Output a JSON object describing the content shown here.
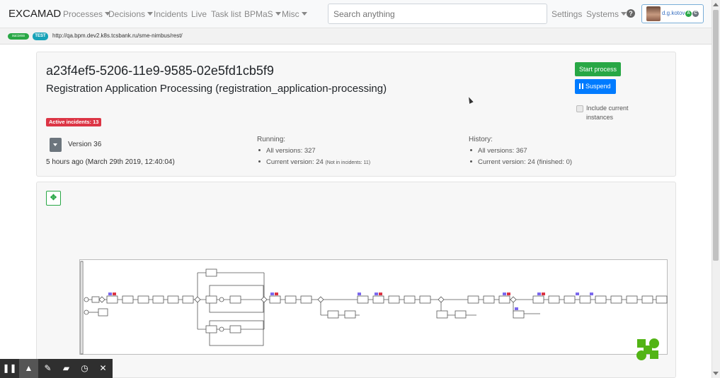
{
  "navbar": {
    "brand": "EXCAMAD",
    "items": [
      {
        "label": "Processes",
        "dropdown": true
      },
      {
        "label": "Decisions",
        "dropdown": true
      },
      {
        "label": "Incidents",
        "dropdown": false
      },
      {
        "label": "Live",
        "dropdown": false
      },
      {
        "label": "Task list",
        "dropdown": false
      },
      {
        "label": "BPMaS",
        "dropdown": true
      },
      {
        "label": "Misc",
        "dropdown": true
      }
    ],
    "search_placeholder": "Search anything",
    "settings": "Settings",
    "systems": "Systems",
    "help_icon": "?",
    "user": {
      "name": "d.g.kotov",
      "badge_a": "A",
      "badge_c": "C"
    }
  },
  "urlbar": {
    "status_badge": "success",
    "env_badge": "TEST",
    "url": "http://qa.bpm.dev2.k8s.tcsbank.ru/sme-nimbus/rest/"
  },
  "process": {
    "id": "a23f4ef5-5206-11e9-9585-02e5fd1cb5f9",
    "name": "Registration Application Processing (registration_application-processing)",
    "start_button": "Start process",
    "suspend_button": "Suspend",
    "include_current": "Include current instances",
    "active_incidents": "Active incidents: 13",
    "version": "Version 36",
    "deployed": "5 hours ago (March 29th 2019, 12:40:04)",
    "running": {
      "title": "Running:",
      "all_versions": "All versions: 327",
      "current_version": "Current version: 24",
      "current_note": "(Not in incidents: 11)"
    },
    "history": {
      "title": "History:",
      "all_versions": "All versions: 367",
      "current_version": "Current version: 24 (finished: 0)"
    }
  },
  "diagram": {
    "move_icon": "✥"
  },
  "toolbar": {
    "pause": "❚❚",
    "pointer": "▲",
    "pen": "✎",
    "eraser": "▰",
    "timer": "◷",
    "close": "✕"
  },
  "colors": {
    "success": "#28a745",
    "primary": "#007bff",
    "danger": "#dc3545",
    "info": "#17a2b8"
  }
}
